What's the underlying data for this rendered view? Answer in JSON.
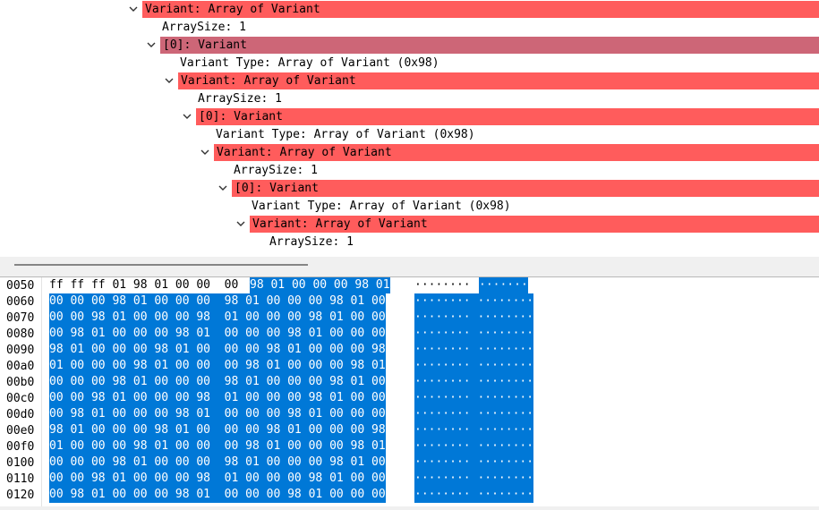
{
  "tree": {
    "rows": [
      {
        "text": "Variant: Array of Variant",
        "expander": true
      },
      {
        "text": "ArraySize: 1",
        "expander": false
      },
      {
        "text": "[0]: Variant",
        "expander": true
      },
      {
        "text": "Variant Type: Array of Variant (0x98)",
        "expander": false
      },
      {
        "text": "Variant: Array of Variant",
        "expander": true
      },
      {
        "text": "ArraySize: 1",
        "expander": false
      },
      {
        "text": "[0]: Variant",
        "expander": true
      },
      {
        "text": "Variant Type: Array of Variant (0x98)",
        "expander": false
      },
      {
        "text": "Variant: Array of Variant",
        "expander": true
      },
      {
        "text": "ArraySize: 1",
        "expander": false
      },
      {
        "text": "[0]: Variant",
        "expander": true
      },
      {
        "text": "Variant Type: Array of Variant (0x98)",
        "expander": false
      },
      {
        "text": "Variant: Array of Variant",
        "expander": true
      },
      {
        "text": "ArraySize: 1",
        "expander": false
      }
    ]
  },
  "hex": {
    "rows": [
      {
        "offset": "0050",
        "p1": "ff ff ff 01 98 01 00 00  00 ",
        "p2": "98 01 00 00 00 98 01",
        "a1": "········ ",
        "a2": "·······"
      },
      {
        "offset": "0060",
        "p1": "",
        "p2": "00 00 00 98 01 00 00 00  98 01 00 00 00 98 01 00",
        "a1": "",
        "a2": "········ ········"
      },
      {
        "offset": "0070",
        "p1": "",
        "p2": "00 00 98 01 00 00 00 98  01 00 00 00 98 01 00 00",
        "a1": "",
        "a2": "········ ········"
      },
      {
        "offset": "0080",
        "p1": "",
        "p2": "00 98 01 00 00 00 98 01  00 00 00 98 01 00 00 00",
        "a1": "",
        "a2": "········ ········"
      },
      {
        "offset": "0090",
        "p1": "",
        "p2": "98 01 00 00 00 98 01 00  00 00 98 01 00 00 00 98",
        "a1": "",
        "a2": "········ ········"
      },
      {
        "offset": "00a0",
        "p1": "",
        "p2": "01 00 00 00 98 01 00 00  00 98 01 00 00 00 98 01",
        "a1": "",
        "a2": "········ ········"
      },
      {
        "offset": "00b0",
        "p1": "",
        "p2": "00 00 00 98 01 00 00 00  98 01 00 00 00 98 01 00",
        "a1": "",
        "a2": "········ ········"
      },
      {
        "offset": "00c0",
        "p1": "",
        "p2": "00 00 98 01 00 00 00 98  01 00 00 00 98 01 00 00",
        "a1": "",
        "a2": "········ ········"
      },
      {
        "offset": "00d0",
        "p1": "",
        "p2": "00 98 01 00 00 00 98 01  00 00 00 98 01 00 00 00",
        "a1": "",
        "a2": "········ ········"
      },
      {
        "offset": "00e0",
        "p1": "",
        "p2": "98 01 00 00 00 98 01 00  00 00 98 01 00 00 00 98",
        "a1": "",
        "a2": "········ ········"
      },
      {
        "offset": "00f0",
        "p1": "",
        "p2": "01 00 00 00 98 01 00 00  00 98 01 00 00 00 98 01",
        "a1": "",
        "a2": "········ ········"
      },
      {
        "offset": "0100",
        "p1": "",
        "p2": "00 00 00 98 01 00 00 00  98 01 00 00 00 98 01 00",
        "a1": "",
        "a2": "········ ········"
      },
      {
        "offset": "0110",
        "p1": "",
        "p2": "00 00 98 01 00 00 00 98  01 00 00 00 98 01 00 00",
        "a1": "",
        "a2": "········ ········"
      },
      {
        "offset": "0120",
        "p1": "",
        "p2": "00 98 01 00 00 00 98 01  00 00 00 98 01 00 00 00",
        "a1": "",
        "a2": "········ ········"
      }
    ]
  },
  "colors": {
    "highlight": "#ff5c5c",
    "selected_highlight": "#cd6677",
    "byte_selection": "#0078d7"
  }
}
